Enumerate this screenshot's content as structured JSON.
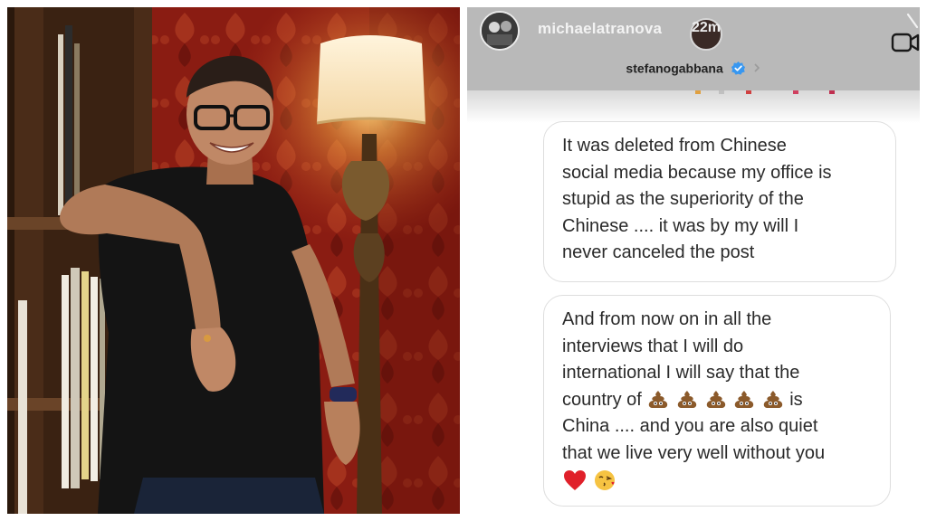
{
  "story": {
    "username": "michaelatranova",
    "timestamp": "22m",
    "recipient": "stefanogabbana",
    "messages": [
      {
        "lines": [
          "It was deleted from Chinese",
          "social media because my office is",
          "stupid as the superiority of the",
          "Chinese .... it was by my will I",
          "never canceled the post"
        ]
      },
      {
        "lines": [
          "And from now on in all the",
          "interviews that I will do",
          "international I will say that the",
          "country of",
          "is",
          "China .... and you are also quiet",
          "that we live very well without you"
        ],
        "emojis_inline": [
          "pile-of-poo-icon",
          "pile-of-poo-icon",
          "pile-of-poo-icon",
          "pile-of-poo-icon",
          "pile-of-poo-icon"
        ],
        "emojis_end": [
          "red-heart-icon",
          "face-blowing-kiss-icon"
        ]
      }
    ]
  },
  "colors": {
    "header_bg": "#b9b9b9",
    "verified_blue": "#3897f0",
    "bubble_border": "#dedede",
    "text": "#2a2a2a",
    "wallpaper_red": "#8c1e14"
  }
}
